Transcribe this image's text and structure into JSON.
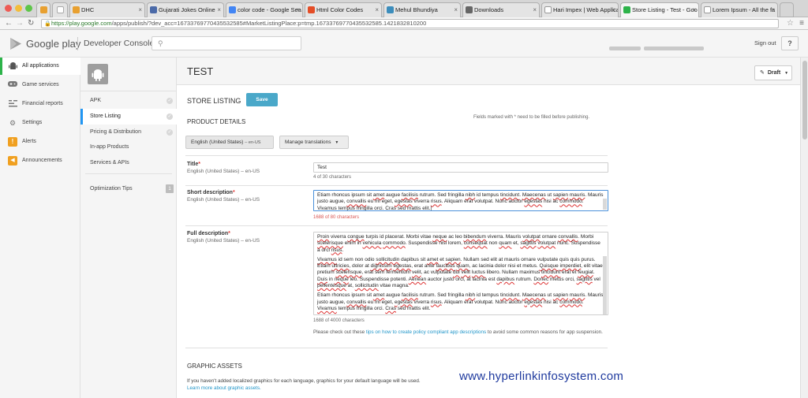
{
  "browser": {
    "tabs": [
      {
        "label": "DHC",
        "color": "#e8a030"
      },
      {
        "label": "Gujarati Jokes Online",
        "color": "#4b6aa8"
      },
      {
        "label": "color code - Google Sea",
        "color": "#4285f4"
      },
      {
        "label": "Html Color Codes",
        "color": "#e44d26"
      },
      {
        "label": "Mehul Bhundiya",
        "color": "#3c8dbc"
      },
      {
        "label": "Downloads",
        "color": "#666666"
      },
      {
        "label": "Hari Impex | Web Applica",
        "color": "#888888"
      },
      {
        "label": "Store Listing - Test - Goo",
        "color": "#2db34a"
      },
      {
        "label": "Lorem Ipsum - All the fa",
        "color": "#777777"
      }
    ],
    "url_host": "https://play.google.com",
    "url_path": "/apps/publish/?dev_acc=16733769770435532585#MarketListingPlace:p=tmp.16733769770435532585.1421832810200"
  },
  "header": {
    "brand": "Google play",
    "console": "Developer Console",
    "signout": "Sign out",
    "help": "?"
  },
  "sidebar": {
    "items": [
      {
        "label": "All applications",
        "icon": "android-icon"
      },
      {
        "label": "Game services",
        "icon": "gamepad-icon"
      },
      {
        "label": "Financial reports",
        "icon": "reports-icon"
      },
      {
        "label": "Settings",
        "icon": "gear-icon"
      },
      {
        "label": "Alerts",
        "icon": "alert-icon"
      },
      {
        "label": "Announcements",
        "icon": "megaphone-icon"
      }
    ]
  },
  "subnav": {
    "items": [
      "APK",
      "Store Listing",
      "Pricing & Distribution",
      "In-app Products",
      "Services & APIs"
    ],
    "optimization": "Optimization Tips",
    "optimization_count": "1"
  },
  "main": {
    "app_title": "TEST",
    "draft": "Draft",
    "store_listing": "STORE LISTING",
    "save": "Save",
    "product_details": "PRODUCT DETAILS",
    "required_note": "Fields marked with * need to be filled before publishing.",
    "lang_btn": "English (United States)",
    "lang_code": "– en-US",
    "manage_translations": "Manage translations"
  },
  "fields": {
    "title": {
      "label": "Title",
      "sub": "English (United States) – en-US",
      "value": "Test",
      "counter": "4 of 30 characters"
    },
    "short": {
      "label": "Short description",
      "sub": "English (United States) – en-US",
      "counter": "1688 of 80 characters"
    },
    "full": {
      "label": "Full description",
      "sub": "English (United States) – en-US",
      "counter": "1688 of 4000 characters"
    }
  },
  "policy": {
    "pre": "Please check out these ",
    "link": "tips on how to create policy compliant app descriptions",
    "post": " to avoid some common reasons for app suspension."
  },
  "graphic_assets": {
    "title": "GRAPHIC ASSETS",
    "text": "If you haven't added localized graphics for each language, graphics for your default language will be used.",
    "link": "Learn more about graphic assets."
  },
  "watermark": "www.hyperlinkinfosystem.com"
}
